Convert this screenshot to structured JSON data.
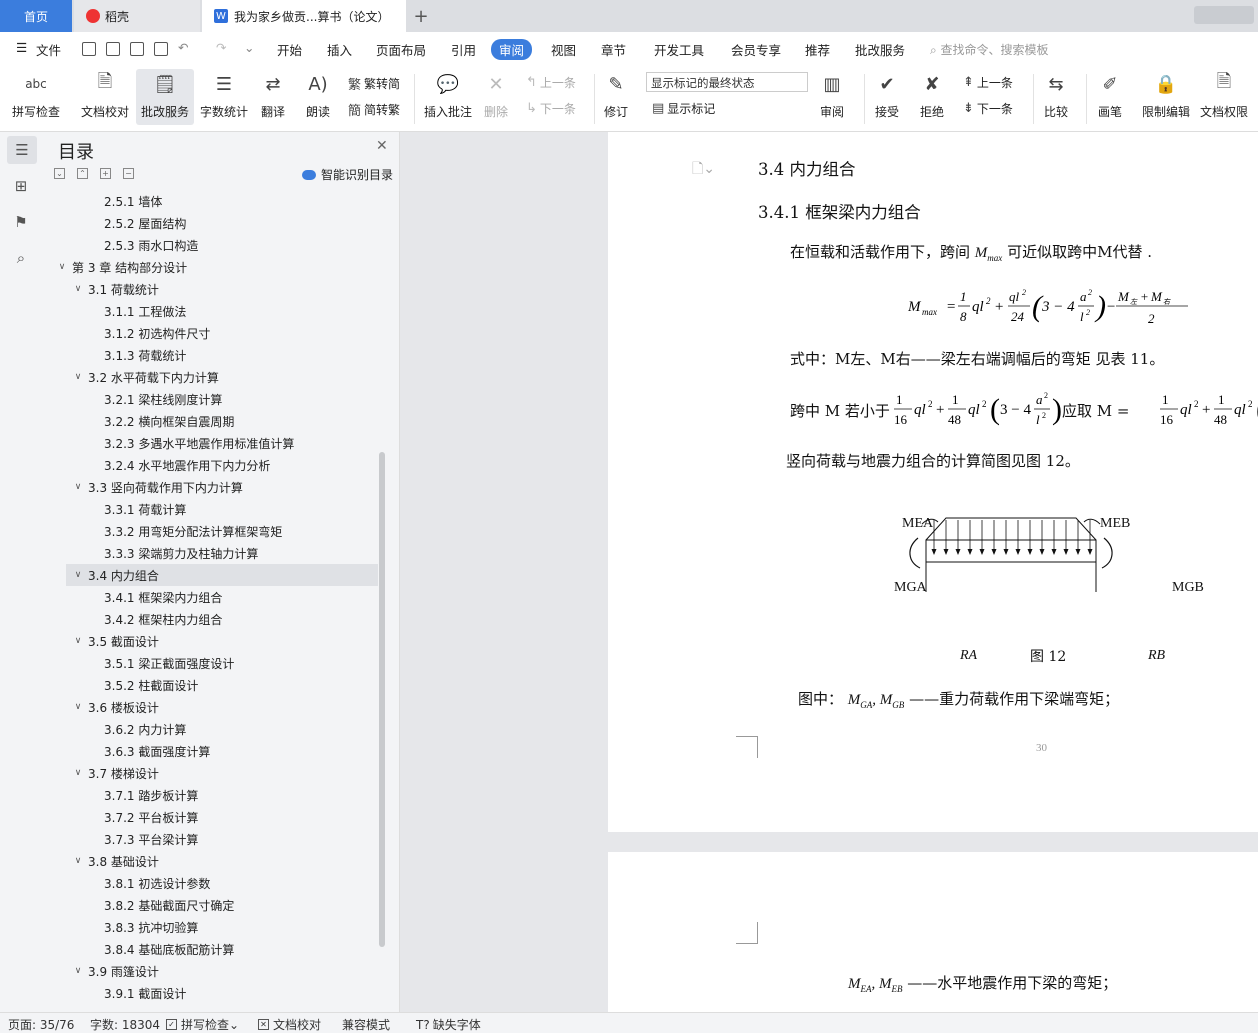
{
  "tabs": {
    "home": "首页",
    "daoke": "稻壳",
    "doc": "我为家乡做贡...算书（论文）",
    "add": "+"
  },
  "menu": {
    "file": "文件",
    "items": [
      "开始",
      "插入",
      "页面布局",
      "引用",
      "审阅",
      "视图",
      "章节",
      "开发工具",
      "会员专享",
      "推荐",
      "批改服务"
    ],
    "active_index": 4,
    "search_placeholder": "查找命令、搜索模板"
  },
  "ribbon": {
    "spell": "拼写检查",
    "doc_check": "文档校对",
    "revise_service": "批改服务",
    "word_count": "字数统计",
    "translate": "翻译",
    "read_aloud": "朗读",
    "trad": "繁转简",
    "simp": "简转繁",
    "insert_comment": "插入批注",
    "delete": "删除",
    "prev": "上一条",
    "next": "下一条",
    "revise": "修订",
    "markup_state": "显示标记的最终状态",
    "show_markup": "显示标记",
    "review": "审阅",
    "accept": "接受",
    "reject": "拒绝",
    "prev2": "上一条",
    "next2": "下一条",
    "compare": "比较",
    "pen": "画笔",
    "restrict": "限制编辑",
    "doc_perm": "文档权限"
  },
  "nav": {
    "title": "目录",
    "smart": "智能识别目录",
    "items": [
      {
        "level": 3,
        "text": "2.5.1 墙体"
      },
      {
        "level": 3,
        "text": "2.5.2 屋面结构"
      },
      {
        "level": 3,
        "text": "2.5.3 雨水口构造"
      },
      {
        "level": 1,
        "text": "第 3 章  结构部分设计",
        "chev": "∨"
      },
      {
        "level": 2,
        "text": "3.1 荷载统计",
        "chev": "∨"
      },
      {
        "level": 3,
        "text": "3.1.1 工程做法"
      },
      {
        "level": 3,
        "text": "3.1.2 初选构件尺寸"
      },
      {
        "level": 3,
        "text": "3.1.3 荷载统计"
      },
      {
        "level": 2,
        "text": "3.2 水平荷载下内力计算",
        "chev": "∨"
      },
      {
        "level": 3,
        "text": "3.2.1  梁柱线刚度计算"
      },
      {
        "level": 3,
        "text": "3.2.2  横向框架自震周期"
      },
      {
        "level": 3,
        "text": "3.2.3  多遇水平地震作用标准值计算"
      },
      {
        "level": 3,
        "text": "3.2.4 水平地震作用下内力分析"
      },
      {
        "level": 2,
        "text": "3.3  竖向荷载作用下内力计算",
        "chev": "∨"
      },
      {
        "level": 3,
        "text": "3.3.1  荷载计算"
      },
      {
        "level": 3,
        "text": "3.3.2  用弯矩分配法计算框架弯矩"
      },
      {
        "level": 3,
        "text": "3.3.3  梁端剪力及柱轴力计算"
      },
      {
        "level": 2,
        "text": "3.4  内力组合",
        "chev": "∨",
        "selected": true
      },
      {
        "level": 3,
        "text": "3.4.1  框架梁内力组合"
      },
      {
        "level": 3,
        "text": "3.4.2 框架柱内力组合"
      },
      {
        "level": 2,
        "text": "3.5  截面设计",
        "chev": "∨"
      },
      {
        "level": 3,
        "text": "3.5.1  梁正截面强度设计"
      },
      {
        "level": 3,
        "text": "3.5.2  柱截面设计"
      },
      {
        "level": 2,
        "text": "3.6  楼板设计",
        "chev": "∨"
      },
      {
        "level": 3,
        "text": "3.6.2  内力计算"
      },
      {
        "level": 3,
        "text": "3.6.3  截面强度计算"
      },
      {
        "level": 2,
        "text": "3.7 楼梯设计",
        "chev": "∨"
      },
      {
        "level": 3,
        "text": "3.7.1  踏步板计算"
      },
      {
        "level": 3,
        "text": "3.7.2  平台板计算"
      },
      {
        "level": 3,
        "text": "3.7.3  平台梁计算"
      },
      {
        "level": 2,
        "text": "3.8  基础设计",
        "chev": "∨"
      },
      {
        "level": 3,
        "text": "3.8.1  初选设计参数"
      },
      {
        "level": 3,
        "text": "3.8.2 基础截面尺寸确定"
      },
      {
        "level": 3,
        "text": "3.8.3 抗冲切验算"
      },
      {
        "level": 3,
        "text": "3.8.4 基础底板配筋计算"
      },
      {
        "level": 2,
        "text": "3.9 雨篷设计",
        "chev": "∨"
      },
      {
        "level": 3,
        "text": "3.9.1  截面设计"
      }
    ]
  },
  "doc": {
    "h1": "3.4  内力组合",
    "h2": "3.4.1  框架梁内力组合",
    "p1_a": "在恒载和活载作用下，跨间",
    "p1_b": "可近似取跨中M代替",
    "formula1": "M<sub>max</sub> = (1/8) ql² + (ql²/24)(3 − 4a²/l²) − (M<sub>左</sub>+M<sub>右</sub>)/2",
    "p2": "式中：M左、M右——梁左右端调幅后的弯矩   见表 11。",
    "p3_a": "跨中 M 若小于",
    "p3_b": "应取",
    "p4": "竖向荷载与地震力组合的计算简图见图 12。",
    "fig_mea": "MEA",
    "fig_meb": "MEB",
    "fig_mga": "MGA",
    "fig_mgb": "MGB",
    "fig_ra": "RA",
    "fig_rb": "RB",
    "fig_caption": "图 12",
    "p5_a": "图中：",
    "p5_b": "——重力荷载作用下梁端弯矩；",
    "page_number": "30",
    "p6_b": "——水平地震作用下梁的弯矩；"
  },
  "status": {
    "page": "页面: 35/76",
    "words": "字数: 18304",
    "spell": "拼写检查",
    "doc_check": "文档校对",
    "compat": "兼容模式",
    "missing_font": "缺失字体"
  }
}
